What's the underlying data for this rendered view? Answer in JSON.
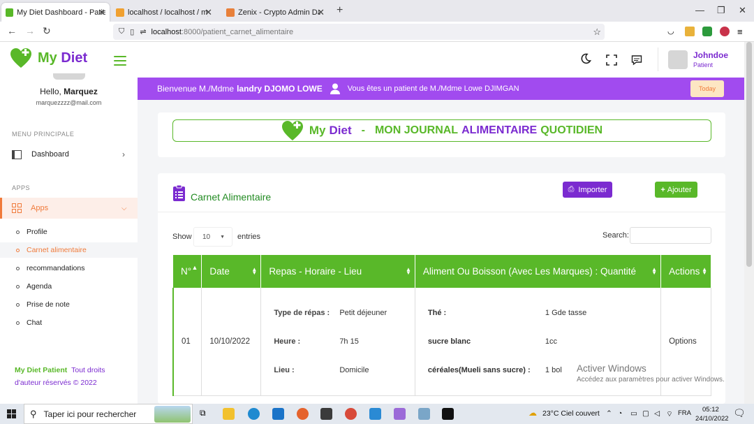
{
  "browser": {
    "tabs": [
      {
        "title": "My Diet Dashboard - Patient",
        "active": true
      },
      {
        "title": "localhost / localhost / mydiet /"
      },
      {
        "title": "Zenix - Crypto Admin Dashboa"
      }
    ],
    "url_host": "localhost",
    "url_path": ":8000/patient_carnet_alimentaire"
  },
  "brand": {
    "my": "My",
    "diet": "Diet"
  },
  "user": {
    "hello_prefix": "Hello,",
    "hello_name": "Marquez",
    "email": "marquezzzz@mail.com",
    "header_name": "Johndoe",
    "header_role": "Patient"
  },
  "sidebar": {
    "section_main": "MENU PRINCIPALE",
    "dashboard": "Dashboard",
    "section_apps": "APPS",
    "apps": "Apps",
    "subitems": [
      "Profile",
      "Carnet alimentaire",
      "recommandations",
      "Agenda",
      "Prise de note",
      "Chat"
    ],
    "footer_brand": "My Diet Patient",
    "footer_rights": "Tout droits d'auteur réservés © 2022"
  },
  "welcome": {
    "prefix": "Bienvenue M./Mdme",
    "name": "landry DJOMO LOWE",
    "patient_of": "Vous êtes un patient de M./Mdme Lowe DJIMGAN",
    "today_btn": "Today"
  },
  "banner": {
    "brand_my": "My",
    "brand_diet": "Diet",
    "dash": "-",
    "w1": "MON JOURNAL",
    "w2": "ALIMENTAIRE",
    "w3": "QUOTIDIEN"
  },
  "carnet": {
    "title": "Carnet Alimentaire",
    "import_btn": "Importer",
    "add_btn": "Ajouter",
    "show": "Show",
    "entries_value": "10",
    "entries": "entries",
    "search_label": "Search:"
  },
  "table": {
    "headers": [
      "N°",
      "Date",
      "Repas - Horaire - Lieu",
      "Aliment Ou Boisson (Avec Les Marques) : Quantité",
      "Actions"
    ],
    "rows": [
      {
        "num": "01",
        "date": "10/10/2022",
        "meal": [
          {
            "k": "Type de répas :",
            "v": "Petit déjeuner"
          },
          {
            "k": "Heure :",
            "v": "7h 15"
          },
          {
            "k": "Lieu :",
            "v": "Domicile"
          }
        ],
        "foods": [
          {
            "k": "Thé :",
            "v": "1 Gde tasse"
          },
          {
            "k": "sucre blanc",
            "v": "1cc"
          },
          {
            "k": "céréales(Mueli sans sucre) :",
            "v": "1 bol"
          }
        ],
        "actions": "Options"
      }
    ]
  },
  "watermark": {
    "line1": "Activer Windows",
    "line2": "Accédez aux paramètres pour activer Windows."
  },
  "taskbar": {
    "search_placeholder": "Taper ici pour rechercher",
    "weather": "23°C  Ciel couvert",
    "lang": "FRA",
    "time": "05:12",
    "date": "24/10/2022"
  },
  "colors": {
    "green": "#59b829",
    "purple": "#7b2bd0",
    "orange": "#f07a3a",
    "banner_purple": "#a14bef"
  }
}
